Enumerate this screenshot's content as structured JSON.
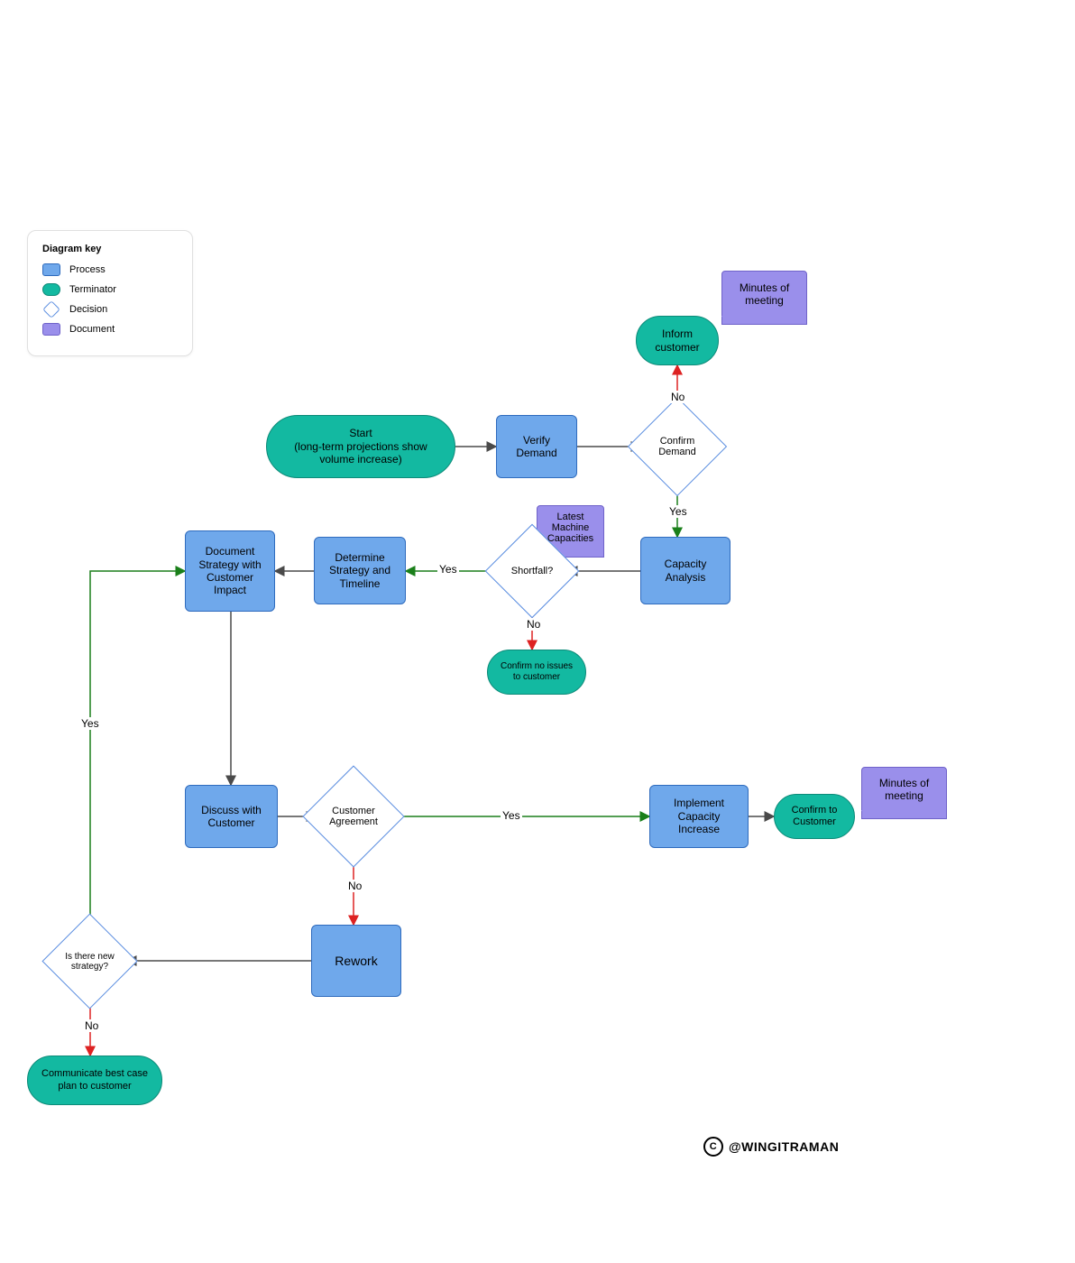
{
  "legend": {
    "title": "Diagram key",
    "items": [
      {
        "label": "Process"
      },
      {
        "label": "Terminator"
      },
      {
        "label": "Decision"
      },
      {
        "label": "Document"
      }
    ]
  },
  "nodes": {
    "start": {
      "text": "Start\n(long-term projections show\nvolume increase)"
    },
    "verify": {
      "text": "Verify\nDemand"
    },
    "confirm": {
      "text": "Confirm\nDemand"
    },
    "inform": {
      "text": "Inform\ncustomer"
    },
    "mom1": {
      "text": "Minutes of\nmeeting"
    },
    "capacity": {
      "text": "Capacity\nAnalysis"
    },
    "latest": {
      "text": "Latest\nMachine\nCapacities"
    },
    "shortfall": {
      "text": "Shortfall?"
    },
    "noissues": {
      "text": "Confirm no issues\nto customer"
    },
    "determine": {
      "text": "Determine\nStrategy and\nTimeline"
    },
    "docstrat": {
      "text": "Document\nStrategy with\nCustomer\nImpact"
    },
    "discuss": {
      "text": "Discuss with\nCustomer"
    },
    "custagree": {
      "text": "Customer\nAgreement"
    },
    "implement": {
      "text": "Implement\nCapacity\nIncrease"
    },
    "confirmto": {
      "text": "Confirm to\nCustomer"
    },
    "mom2": {
      "text": "Minutes of\nmeeting"
    },
    "rework": {
      "text": "Rework"
    },
    "newstrat": {
      "text": "Is there new\nstrategy?"
    },
    "bestcase": {
      "text": "Communicate best case\nplan to customer"
    }
  },
  "edge_labels": {
    "confirm_no": "No",
    "confirm_yes": "Yes",
    "shortfall_yes": "Yes",
    "shortfall_no": "No",
    "custagree_yes": "Yes",
    "custagree_no": "No",
    "newstrat_yes": "Yes",
    "newstrat_no": "No"
  },
  "colors": {
    "process": "#6fa8eb",
    "terminator": "#13b9a1",
    "decision_border": "#5a8de0",
    "document": "#9a8feb",
    "arrow_default": "#4a4a4a",
    "arrow_yes": "#1a7f1a",
    "arrow_no": "#d22"
  },
  "watermark": "@WINGITRAMAN"
}
